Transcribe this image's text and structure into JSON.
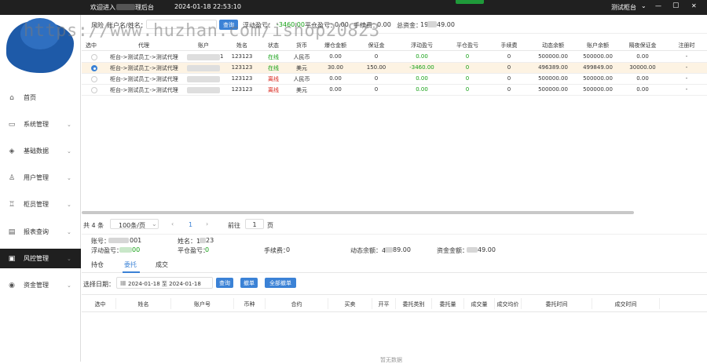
{
  "titlebar": {
    "welcome": "欢迎进入",
    "welcome_suffix": "理后台",
    "datetime": "2024-01-18 22:53:10",
    "user": "测试柜台",
    "minimize": "—",
    "maximize": "▢",
    "close": "✕"
  },
  "watermark": "https://www.huzhan.com/ishop20823",
  "sidebar": {
    "items": [
      {
        "label": "首页",
        "icon": "home-icon",
        "glyph": "⌂",
        "has_children": false
      },
      {
        "label": "系统管理",
        "icon": "monitor-icon",
        "glyph": "▭",
        "has_children": true
      },
      {
        "label": "基础数据",
        "icon": "layers-icon",
        "glyph": "◈",
        "has_children": true
      },
      {
        "label": "用户管理",
        "icon": "user-icon",
        "glyph": "♙",
        "has_children": true
      },
      {
        "label": "柜员管理",
        "icon": "staff-icon",
        "glyph": "♖",
        "has_children": true
      },
      {
        "label": "报表查询",
        "icon": "report-icon",
        "glyph": "▤",
        "has_children": true
      },
      {
        "label": "风控管理",
        "icon": "risk-icon",
        "glyph": "▣",
        "has_children": true,
        "active": true
      },
      {
        "label": "资金管理",
        "icon": "fund-icon",
        "glyph": "◉",
        "has_children": true
      }
    ]
  },
  "filter": {
    "risk_label": "风险",
    "account_label": "账户名/姓名：",
    "search": "查询",
    "float_pl_label": "浮动盈亏：",
    "float_pl_value": "-3460.00",
    "close_pl_label": "平仓盈亏：",
    "close_pl_value": "0.00",
    "fee_label": "手续费：",
    "fee_value": "0.00",
    "total_label": "总资金：",
    "total_value": "19",
    "total_suffix": "49.00"
  },
  "table": {
    "headers": [
      "选中",
      "代理",
      "账户",
      "姓名",
      "状态",
      "货币",
      "爆仓金额",
      "保证金",
      "浮动盈亏",
      "平仓盈亏",
      "手续费",
      "动态余额",
      "账户余额",
      "隔夜保证金",
      "注册时"
    ],
    "rows": [
      {
        "agent": "柜台->测试员工->测试代理",
        "account_suffix": "1",
        "name": "123123",
        "status": "在线",
        "status_color": "green",
        "currency": "人民币",
        "liq": "0.00",
        "margin": "0",
        "float": "0.00",
        "close": "0",
        "fee": "0",
        "dynamic": "500000.00",
        "balance": "500000.00",
        "overnight": "0.00",
        "reg": "-",
        "selected": false
      },
      {
        "agent": "柜台->测试员工->测试代理",
        "account_suffix": "",
        "name": "123123",
        "status": "在线",
        "status_color": "green",
        "currency": "美元",
        "liq": "30.00",
        "margin": "150.00",
        "float": "-3460.00",
        "close": "0",
        "fee": "0",
        "dynamic": "496389.00",
        "balance": "499849.00",
        "overnight": "30000.00",
        "reg": "-",
        "selected": true
      },
      {
        "agent": "柜台->测试员工->测试代理",
        "account_suffix": "",
        "name": "123123",
        "status": "离线",
        "status_color": "red",
        "currency": "人民币",
        "liq": "0.00",
        "margin": "0",
        "float": "0.00",
        "close": "0",
        "fee": "0",
        "dynamic": "500000.00",
        "balance": "500000.00",
        "overnight": "0.00",
        "reg": "-",
        "selected": false
      },
      {
        "agent": "柜台->测试员工->测试代理",
        "account_suffix": "",
        "name": "123123",
        "status": "离线",
        "status_color": "red",
        "currency": "美元",
        "liq": "0.00",
        "margin": "0",
        "float": "0.00",
        "close": "0",
        "fee": "0",
        "dynamic": "500000.00",
        "balance": "500000.00",
        "overnight": "0.00",
        "reg": "-",
        "selected": false
      }
    ]
  },
  "pagination": {
    "total": "共 4 条",
    "page_size": "100条/页",
    "prev": "‹",
    "current": "1",
    "next": "›",
    "goto": "前往",
    "goto_value": "1",
    "page_unit": "页"
  },
  "detail": {
    "account_label": "账号：",
    "account_suffix": "001",
    "name_label": "姓名：1",
    "name_suffix": "23",
    "float_label": "浮动盈亏：",
    "float_suffix": "00",
    "close_label": "平仓盈亏：",
    "close_value": "0",
    "fee_label": "手续费：",
    "fee_value": "0",
    "dynamic_label": "动态余额：4",
    "dynamic_suffix": "89.00",
    "total_label": "资金金额：",
    "total_suffix": "49.00"
  },
  "tabs": [
    "持仓",
    "委托",
    "成交"
  ],
  "active_tab": 1,
  "orders": {
    "date_label": "选择日期：",
    "date_range": "2024-01-18 至 2024-01-18",
    "search": "查询",
    "cancel": "撤单",
    "cancel_all": "全部撤单",
    "headers": [
      "选中",
      "姓名",
      "账户号",
      "币种",
      "合约",
      "买卖",
      "开平",
      "委托类别",
      "委托量",
      "成交量",
      "成交均价",
      "委托时间",
      "成交时间"
    ],
    "empty": "暂无数据"
  },
  "colors": {
    "accent": "#3b82d6",
    "dark": "#1f1f1f",
    "green": "#15a015",
    "red": "#d9261c"
  }
}
